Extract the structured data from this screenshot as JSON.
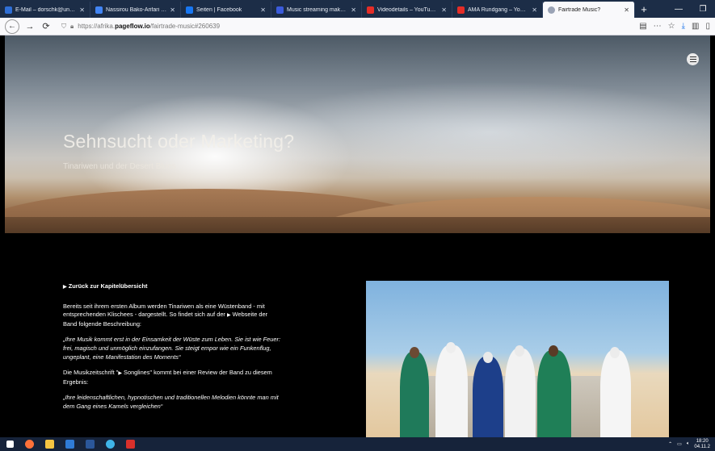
{
  "browser": {
    "tabs": [
      {
        "title": "E-Mail – dorschk@uni-mu",
        "color": "#2f6fd6"
      },
      {
        "title": "Nassirou Bako-Arifari i – Go",
        "color": "#4285f4"
      },
      {
        "title": "Seiten | Facebook",
        "color": "#1877f2"
      },
      {
        "title": "Music streaming makes mu",
        "color": "#3b5bdb"
      },
      {
        "title": "Videodetails – YouTube Stu",
        "color": "#e52d27"
      },
      {
        "title": "AMA Rundgang – YouTube",
        "color": "#e52d27"
      },
      {
        "title": "Fairtrade Music?",
        "color": "#9aa3b5",
        "active": true
      }
    ],
    "url_prefix": "https://afrika.",
    "url_domain": "pageflow.io",
    "url_path": "/fairtrade-music#260639"
  },
  "hero": {
    "title": "Sehnsucht oder Marketing?",
    "subtitle": "Tinariwen und der Desert Blues"
  },
  "article": {
    "back_link": "Zurück zur Kapitelübersicht",
    "p1_before": "Bereits seit ihrem ersten Album werden Tinariwen als eine Wüstenband - mit entsprechenden Klischees - dargestellt. So findet sich auf der ",
    "p1_link": "Webseite der Band",
    "p1_after": " folgende Beschreibung:",
    "quote1": "„Ihre Musik kommt erst in der Einsamkeit der Wüste zum Leben. Sie ist wie Feuer: frei, magisch und unmöglich einzufangen. Sie steigt empor wie ein Funkenflug, ungeplant, eine Manifestation des Moments“",
    "p2_before": "Die Musikzeitschrift \"",
    "p2_link": "Songlines",
    "p2_after": "\" kommt bei einer Review der Band zu diesem Ergebnis:",
    "quote2": "„Ihre leidenschaftlichen, hypnotischen und traditionellen Melodien könnte man mit dem Gang eines Kamels vergleichen“"
  },
  "taskbar": {
    "clock": "18:20",
    "date": "04.11.2"
  }
}
